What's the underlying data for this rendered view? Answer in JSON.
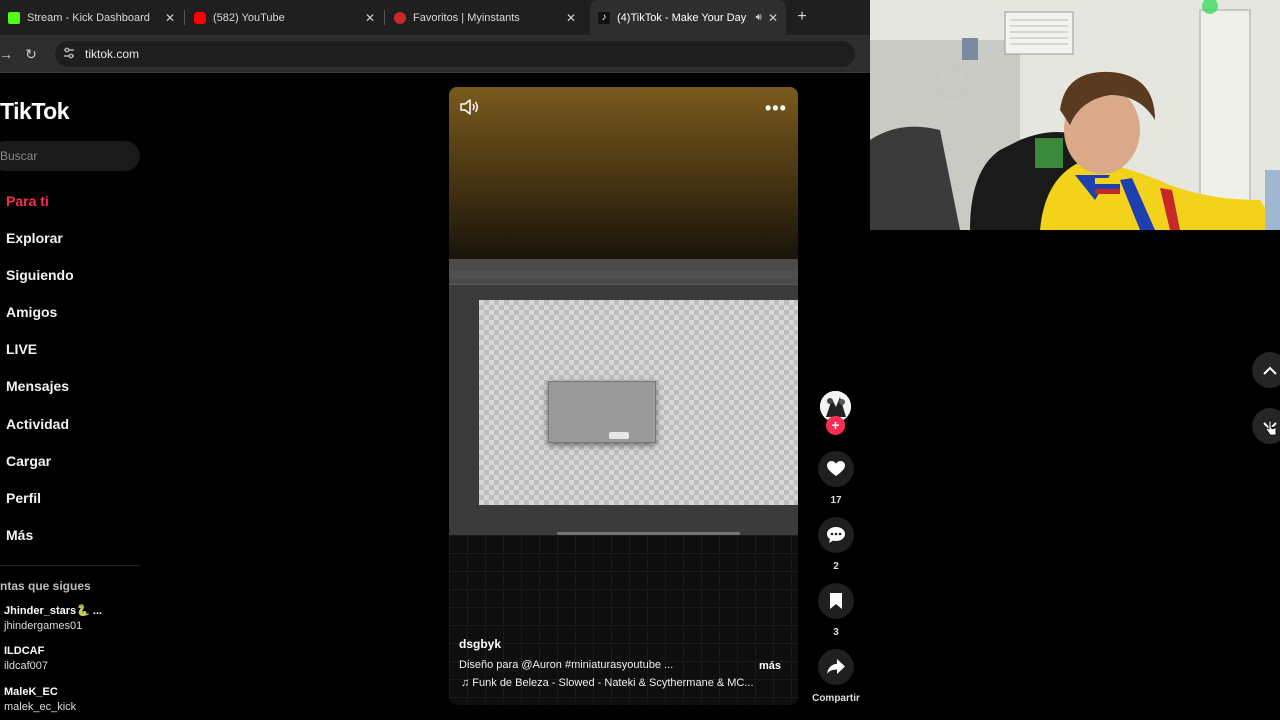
{
  "browser": {
    "tabs": [
      {
        "title": "Stream - Kick Dashboard",
        "favicon_color": "#53fc18"
      },
      {
        "title": "(582) YouTube",
        "favicon_color": "#ff0000"
      },
      {
        "title": "Favoritos | Myinstants",
        "favicon_color": "#c62828"
      },
      {
        "title": "(4)TikTok - Make Your Day",
        "favicon_color": "#111111"
      }
    ],
    "url": "tiktok.com"
  },
  "sidebar": {
    "logo": "TikTok",
    "search_placeholder": "Buscar",
    "nav": [
      {
        "label": "Para ti",
        "active": true
      },
      {
        "label": "Explorar"
      },
      {
        "label": "Siguiendo"
      },
      {
        "label": "Amigos"
      },
      {
        "label": "LIVE"
      },
      {
        "label": "Mensajes"
      },
      {
        "label": "Actividad"
      },
      {
        "label": "Cargar"
      },
      {
        "label": "Perfil"
      },
      {
        "label": "Más"
      }
    ],
    "following_title": "ntas que sigues",
    "following": [
      {
        "name": "Jhinder_stars🐍 ...",
        "handle": "jhindergames01"
      },
      {
        "name": "ILDCAF",
        "handle": "ildcaf007"
      },
      {
        "name": "MaleK_EC",
        "handle": "malek_ec_kick"
      }
    ]
  },
  "video": {
    "author": "dsgbyk",
    "description": "Diseño para @Auron  #miniaturasyoutube  ...",
    "more_label": "más",
    "music": "♫  Funk de Beleza - Slowed - Nateki & Scythermane & MC..."
  },
  "actions": {
    "likes": "17",
    "comments": "2",
    "saves": "3",
    "share_label": "Compartir"
  },
  "colors": {
    "accent": "#fe2c55"
  }
}
